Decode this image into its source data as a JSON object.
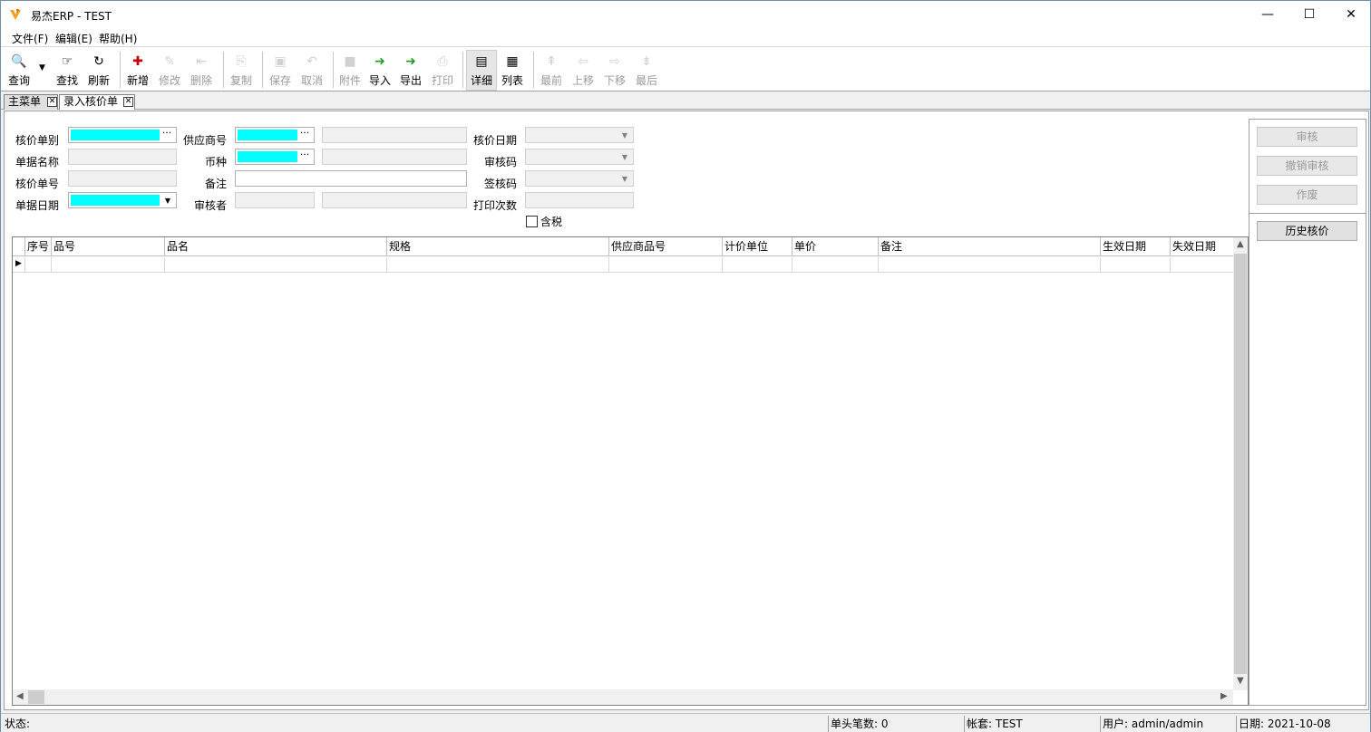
{
  "window": {
    "title": "易杰ERP - TEST",
    "minimize": "—",
    "maximize": "☐",
    "close": "✕"
  },
  "menu": [
    "文件(F)",
    "编辑(E)",
    "帮助(H)"
  ],
  "toolbar": {
    "query": "查询",
    "find": "查找",
    "refresh": "刷新",
    "add": "新增",
    "edit": "修改",
    "delete": "删除",
    "copy": "复制",
    "save": "保存",
    "cancel": "取消",
    "attach": "附件",
    "import": "导入",
    "export": "导出",
    "print": "打印",
    "detail": "详细",
    "list": "列表",
    "first": "最前",
    "up": "上移",
    "down": "下移",
    "last": "最后"
  },
  "tabs": [
    "主菜单",
    "录入核价单"
  ],
  "form": {
    "price_type": "核价单别",
    "supplier_no": "供应商号",
    "price_date": "核价日期",
    "doc_name": "单据名称",
    "currency": "币种",
    "audit_code": "审核码",
    "price_no": "核价单号",
    "remark": "备注",
    "sign_code": "签核码",
    "doc_date": "单据日期",
    "auditor": "审核者",
    "print_count": "打印次数",
    "tax_included": "含税"
  },
  "grid": {
    "columns": [
      "序号",
      "品号",
      "品名",
      "规格",
      "供应商品号",
      "计价单位",
      "单价",
      "备注",
      "生效日期",
      "失效日期"
    ]
  },
  "side_buttons": {
    "audit": "审核",
    "cancel_audit": "撤销审核",
    "void": "作废",
    "history": "历史核价"
  },
  "status": {
    "label": "状态:",
    "count": "单头笔数: 0",
    "account": "帐套: TEST",
    "user": "用户: admin/admin",
    "date": "日期: 2021-10-08"
  }
}
